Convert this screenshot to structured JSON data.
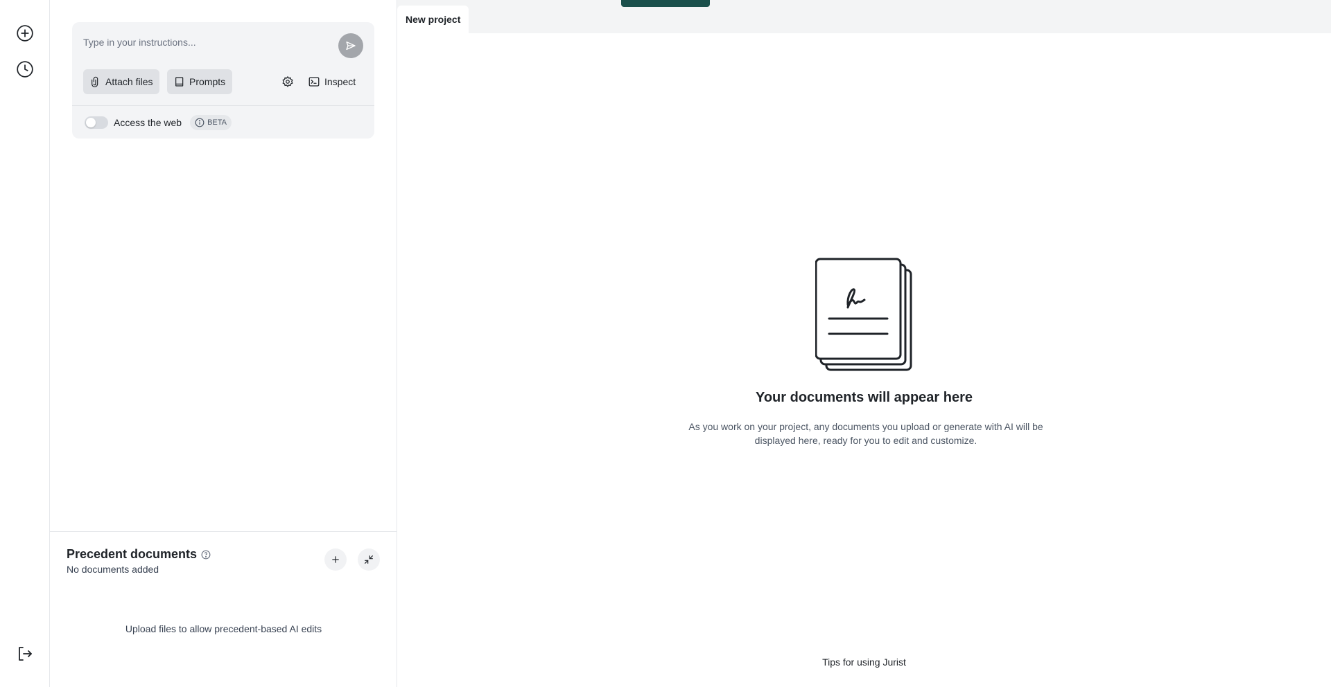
{
  "rail": {
    "new_icon": "plus-circle-icon",
    "history_icon": "clock-icon",
    "logout_icon": "logout-icon"
  },
  "composer": {
    "placeholder": "Type in your instructions...",
    "attach_label": "Attach files",
    "prompts_label": "Prompts",
    "inspect_label": "Inspect",
    "web_label": "Access the web",
    "web_enabled": false,
    "beta_label": "BETA"
  },
  "precedent": {
    "title": "Precedent documents",
    "subtitle": "No documents added",
    "empty_text": "Upload files to allow precedent-based AI edits"
  },
  "docs": {
    "tab_label": "New project",
    "empty_title": "Your documents will appear here",
    "empty_desc": "As you work on your project, any documents you upload or generate with AI will be displayed here, ready for you to edit and customize.",
    "tips_label": "Tips for using Jurist"
  },
  "colors": {
    "accent": "#1a4f4b",
    "send_disabled": "#a3a6ab",
    "panel_bg": "#f3f4f6"
  }
}
